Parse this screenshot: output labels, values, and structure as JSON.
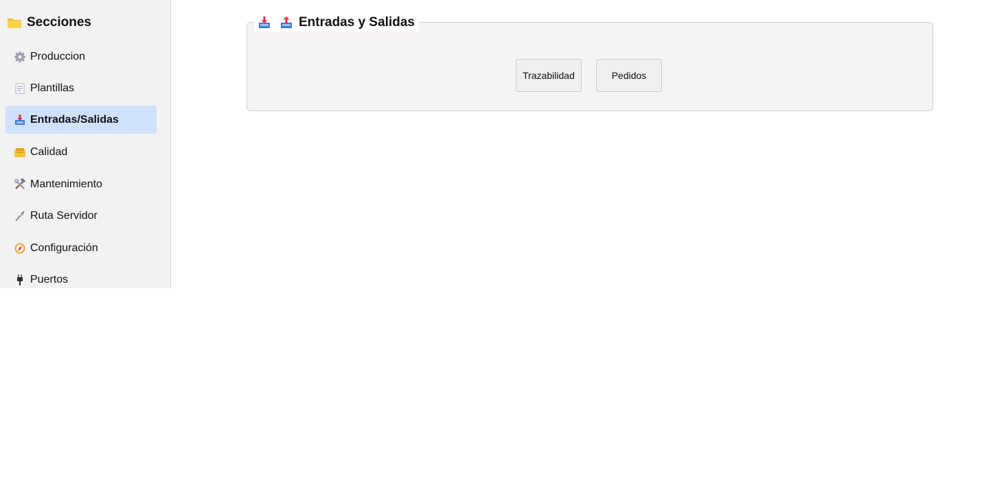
{
  "sidebar": {
    "title": "Secciones",
    "title_icon": "folder-icon",
    "items": [
      {
        "label": "Produccion",
        "icon": "gear-icon",
        "active": false
      },
      {
        "label": "Plantillas",
        "icon": "document-icon",
        "active": false
      },
      {
        "label": "Entradas/Salidas",
        "icon": "inbox-tray-icon",
        "active": true
      },
      {
        "label": "Calidad",
        "icon": "card-index-icon",
        "active": false
      },
      {
        "label": "Mantenimiento",
        "icon": "hammer-wrench-icon",
        "active": false
      },
      {
        "label": "Ruta Servidor",
        "icon": "satellite-icon",
        "active": false
      },
      {
        "label": "Configuración",
        "icon": "compass-icon",
        "active": false
      },
      {
        "label": "Puertos",
        "icon": "plug-icon",
        "active": false
      }
    ]
  },
  "panel": {
    "title": "Entradas y Salidas",
    "icons": [
      "inbox-tray-icon",
      "outbox-tray-icon"
    ],
    "buttons": [
      {
        "label": "Trazabilidad"
      },
      {
        "label": "Pedidos"
      }
    ]
  },
  "colors": {
    "sidebar_bg": "#f2f2f2",
    "active_item_bg": "#d0e1fb",
    "panel_bg": "#f6f3f3",
    "button_bg": "#efefef"
  }
}
